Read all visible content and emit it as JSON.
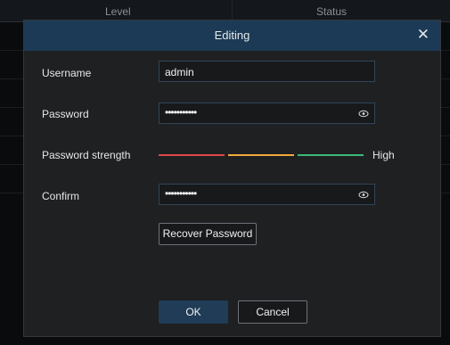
{
  "background_table": {
    "columns": [
      "Level",
      "Status"
    ]
  },
  "dialog": {
    "title": "Editing",
    "close_icon": "close-icon",
    "fields": {
      "username": {
        "label": "Username",
        "value": "admin"
      },
      "password": {
        "label": "Password",
        "value": "•••••••••••",
        "icon": "eye-icon"
      },
      "strength": {
        "label": "Password strength",
        "level": "High",
        "colors": [
          "#e0474c",
          "#f2a93b",
          "#3cb878"
        ]
      },
      "confirm": {
        "label": "Confirm",
        "value": "•••••••••••",
        "icon": "eye-icon"
      }
    },
    "buttons": {
      "recover": "Recover Password",
      "ok": "OK",
      "cancel": "Cancel"
    }
  }
}
